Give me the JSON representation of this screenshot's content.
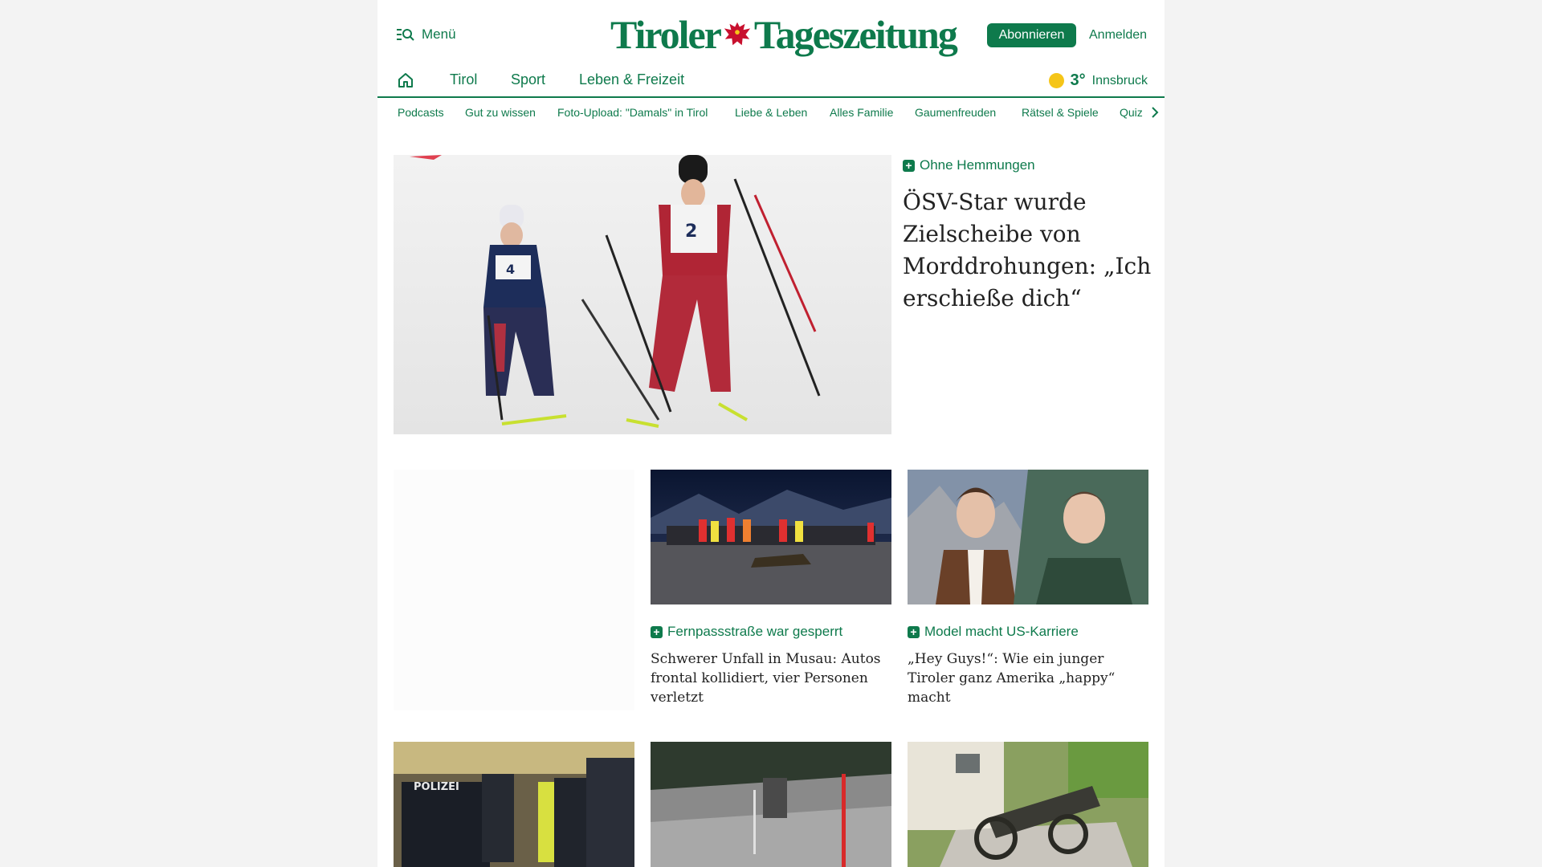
{
  "header": {
    "menu_label": "Menü",
    "logo_left": "Tiroler",
    "logo_right": "Tageszeitung",
    "subscribe_label": "Abonnieren",
    "login_label": "Anmelden"
  },
  "main_nav": {
    "items": [
      {
        "label": "Tirol"
      },
      {
        "label": "Sport"
      },
      {
        "label": "Leben & Freizeit"
      }
    ]
  },
  "weather": {
    "temperature": "3°",
    "city": "Innsbruck"
  },
  "sub_nav": {
    "items": [
      {
        "label": "Podcasts"
      },
      {
        "label": "Gut zu wissen"
      },
      {
        "label": "Foto-Upload: \"Damals\" in Tirol"
      },
      {
        "label": "Liebe & Leben"
      },
      {
        "label": "Alles Familie"
      },
      {
        "label": "Gaumenfreuden"
      },
      {
        "label": "Rätsel & Spiele"
      },
      {
        "label": "Quiz"
      }
    ]
  },
  "hero": {
    "kicker": "Ohne Hemmungen",
    "title": "ÖSV-Star wurde Zielscheibe von Morddrohungen: „Ich erschieße dich“",
    "bib_left": "4",
    "bib_right": "2"
  },
  "cards": [
    {
      "kicker": "Fernpassstraße war gesperrt",
      "title": "Schwerer Unfall in Musau: Autos frontal kollidiert, vier Personen verletzt"
    },
    {
      "kicker": "Model macht US-Karriere",
      "title": "„Hey Guys!“: Wie ein junger Tiroler ganz Amerika „happy“ macht"
    }
  ],
  "bottom_images": [
    {
      "overlay": "POLIZEI"
    },
    {
      "overlay": ""
    },
    {
      "overlay": ""
    }
  ],
  "colors": {
    "brand": "#0e7a4c",
    "sun": "#f5c518"
  }
}
